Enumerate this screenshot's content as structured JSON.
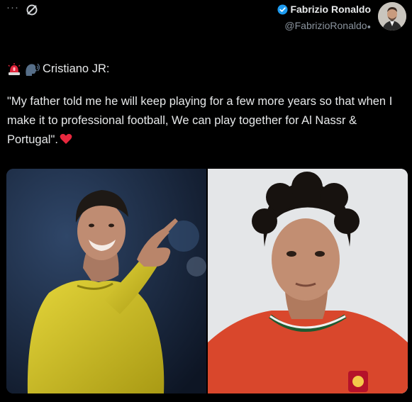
{
  "topbar": {
    "more_glyph": "···"
  },
  "author": {
    "name": "Fabrizio Ronaldo",
    "handle": "@FabrizioRonaldo",
    "handle_suffix": "●",
    "verified_color": "#1d9bf0"
  },
  "post": {
    "prefix_emojis": [
      "siren-emoji",
      "speaking-head-emoji"
    ],
    "speaker": "Cristiano JR:",
    "quote": "\"My father told me he will keep playing for a few more years so that when I make it to professional football, We can play together for Al Nassr & Portugal\".",
    "heart_color": "#e8283e"
  },
  "media": {
    "left_photo": "cristiano-yellow-jersey-pointing",
    "right_photo": "junior-portugal-red-jersey-portrait"
  },
  "colors": {
    "background": "#000000",
    "text": "#e7e9ea",
    "muted": "#8b949e"
  }
}
